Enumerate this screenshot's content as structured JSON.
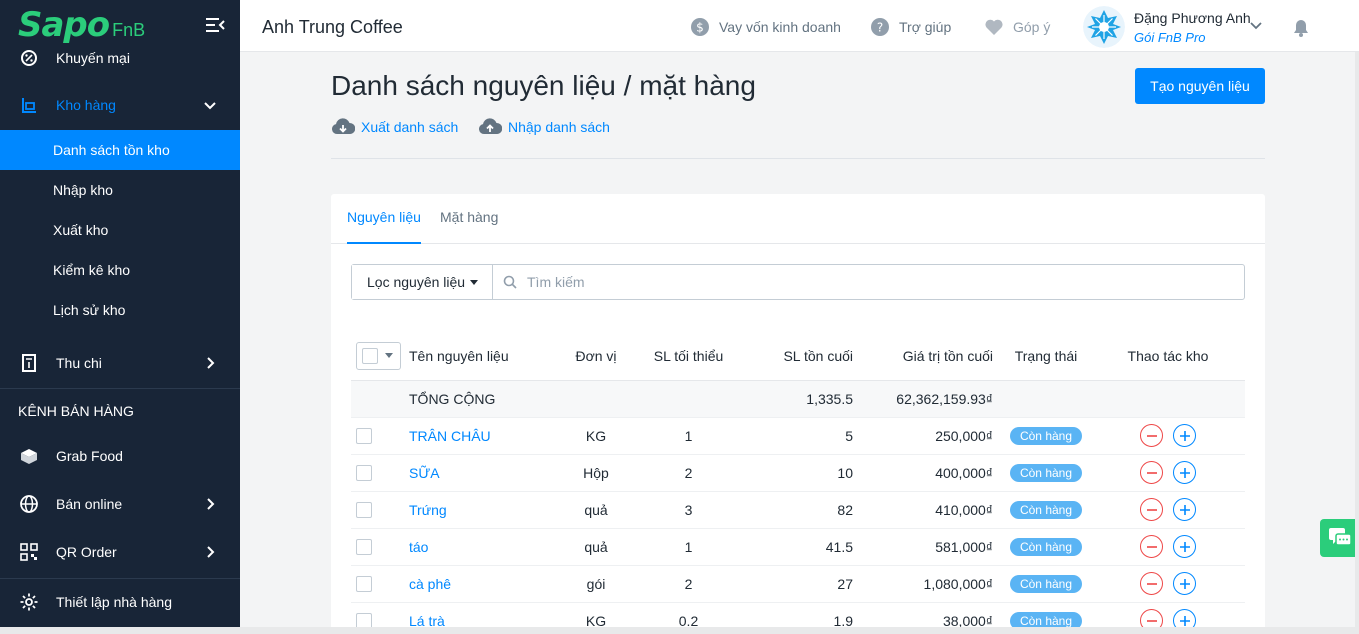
{
  "brand": {
    "logo_main": "Sapo",
    "logo_sub": "FnB",
    "color": "#2bcd7b"
  },
  "sidebar": {
    "items": [
      {
        "label": "Khuyến mại",
        "icon": "promotion-icon"
      },
      {
        "label": "Kho hàng",
        "icon": "warehouse-icon"
      },
      {
        "label": "Thu chi",
        "icon": "cashbook-icon"
      },
      {
        "label": "Grab Food",
        "icon": "grabfood-icon"
      },
      {
        "label": "Bán online",
        "icon": "globe-icon"
      },
      {
        "label": "QR Order",
        "icon": "qr-code-icon"
      },
      {
        "label": "Thiết lập nhà hàng",
        "icon": "gear-icon"
      }
    ],
    "sub_items": [
      {
        "label": "Danh sách tồn kho",
        "active": true
      },
      {
        "label": "Nhập kho"
      },
      {
        "label": "Xuất kho"
      },
      {
        "label": "Kiểm kê kho"
      },
      {
        "label": "Lịch sử kho"
      }
    ],
    "section_sales_channels": "KÊNH BÁN HÀNG"
  },
  "header": {
    "store_name": "Anh Trung Coffee",
    "loan_link": "Vay vốn kinh doanh",
    "help_link": "Trợ giúp",
    "feedback_link": "Góp ý",
    "user_name": "Đặng Phương Anh",
    "user_plan": "Gói FnB Pro"
  },
  "page": {
    "title": "Danh sách nguyên liệu / mặt hàng",
    "create_button": "Tạo nguyên liệu",
    "export_link": "Xuất danh sách",
    "import_link": "Nhập danh sách"
  },
  "tabs": [
    {
      "label": "Nguyên liệu",
      "active": true
    },
    {
      "label": "Mặt hàng"
    }
  ],
  "filter": {
    "dropdown_label": "Lọc nguyên liệu",
    "search_placeholder": "Tìm kiếm"
  },
  "table": {
    "headers": [
      "Tên nguyên liệu",
      "Đơn vị",
      "SL tối thiểu",
      "SL tồn cuối",
      "Giá trị tồn cuối",
      "Trạng thái",
      "Thao tác kho"
    ],
    "total": {
      "label": "TỔNG CỘNG",
      "end_qty": "1,335.5",
      "end_value": "62,362,159.93₫"
    },
    "rows": [
      {
        "name": "TRÂN CHÂU",
        "unit": "KG",
        "min": "1",
        "end": "5",
        "value": "250,000₫",
        "status": "Còn hàng"
      },
      {
        "name": "SỮA",
        "unit": "Hộp",
        "min": "2",
        "end": "10",
        "value": "400,000₫",
        "status": "Còn hàng"
      },
      {
        "name": "Trứng",
        "unit": "quả",
        "min": "3",
        "end": "82",
        "value": "410,000₫",
        "status": "Còn hàng"
      },
      {
        "name": "táo",
        "unit": "quả",
        "min": "1",
        "end": "41.5",
        "value": "581,000₫",
        "status": "Còn hàng"
      },
      {
        "name": "cà phê",
        "unit": "gói",
        "min": "2",
        "end": "27",
        "value": "1,080,000₫",
        "status": "Còn hàng"
      },
      {
        "name": "Lá trà",
        "unit": "KG",
        "min": "0.2",
        "end": "1.9",
        "value": "38,000₫",
        "status": "Còn hàng"
      }
    ]
  },
  "colors": {
    "primary": "#0088ff",
    "sidebar_bg": "#182537",
    "badge": "#5ab4f4",
    "minus": "#ee4747"
  }
}
